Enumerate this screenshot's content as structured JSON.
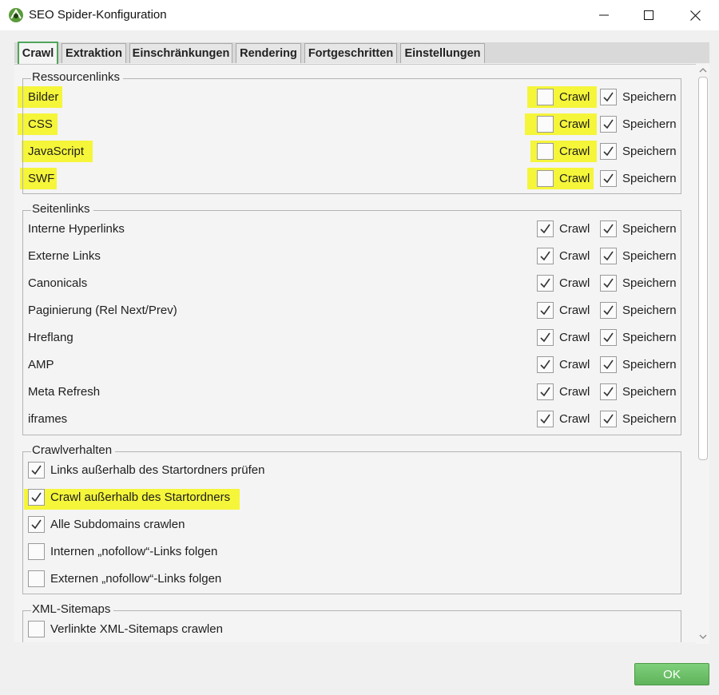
{
  "window": {
    "title": "SEO Spider-Konfiguration",
    "icon": "spider-logo-icon",
    "controls": [
      "minimize-icon",
      "maximize-icon",
      "close-icon"
    ]
  },
  "tabs": [
    {
      "label": "Crawl",
      "active": true
    },
    {
      "label": "Extraktion",
      "active": false
    },
    {
      "label": "Einschränkungen",
      "active": false
    },
    {
      "label": "Rendering",
      "active": false
    },
    {
      "label": "Fortgeschritten",
      "active": false
    },
    {
      "label": "Einstellungen",
      "active": false
    }
  ],
  "resource_links": {
    "title": "Ressourcenlinks",
    "crawl_label": "Crawl",
    "store_label": "Speichern",
    "rows": [
      {
        "label": "Bilder",
        "crawl": false,
        "store": true
      },
      {
        "label": "CSS",
        "crawl": false,
        "store": true
      },
      {
        "label": "JavaScript",
        "crawl": false,
        "store": true
      },
      {
        "label": "SWF",
        "crawl": false,
        "store": true
      }
    ]
  },
  "page_links": {
    "title": "Seitenlinks",
    "crawl_label": "Crawl",
    "store_label": "Speichern",
    "rows": [
      {
        "label": "Interne Hyperlinks",
        "crawl": true,
        "store": true
      },
      {
        "label": "Externe Links",
        "crawl": true,
        "store": true
      },
      {
        "label": "Canonicals",
        "crawl": true,
        "store": true
      },
      {
        "label": "Paginierung (Rel Next/Prev)",
        "crawl": true,
        "store": true
      },
      {
        "label": "Hreflang",
        "crawl": true,
        "store": true
      },
      {
        "label": "AMP",
        "crawl": true,
        "store": true
      },
      {
        "label": "Meta Refresh",
        "crawl": true,
        "store": true
      },
      {
        "label": "iframes",
        "crawl": true,
        "store": true
      }
    ]
  },
  "crawl_behavior": {
    "title": "Crawlverhalten",
    "options": [
      {
        "label": "Links außerhalb des Startordners prüfen",
        "checked": true
      },
      {
        "label": "Crawl außerhalb des Startordners",
        "checked": true
      },
      {
        "label": "Alle Subdomains crawlen",
        "checked": true
      },
      {
        "label": "Internen „nofollow“-Links folgen",
        "checked": false
      },
      {
        "label": "Externen „nofollow“-Links folgen",
        "checked": false
      }
    ]
  },
  "xml_sitemaps": {
    "title": "XML-Sitemaps",
    "options": [
      {
        "label": "Verlinkte XML-Sitemaps crawlen",
        "checked": false
      }
    ]
  },
  "footer": {
    "ok_label": "OK"
  },
  "colors": {
    "highlight": "#f5f53a",
    "accent_green": "#5fb35a"
  }
}
